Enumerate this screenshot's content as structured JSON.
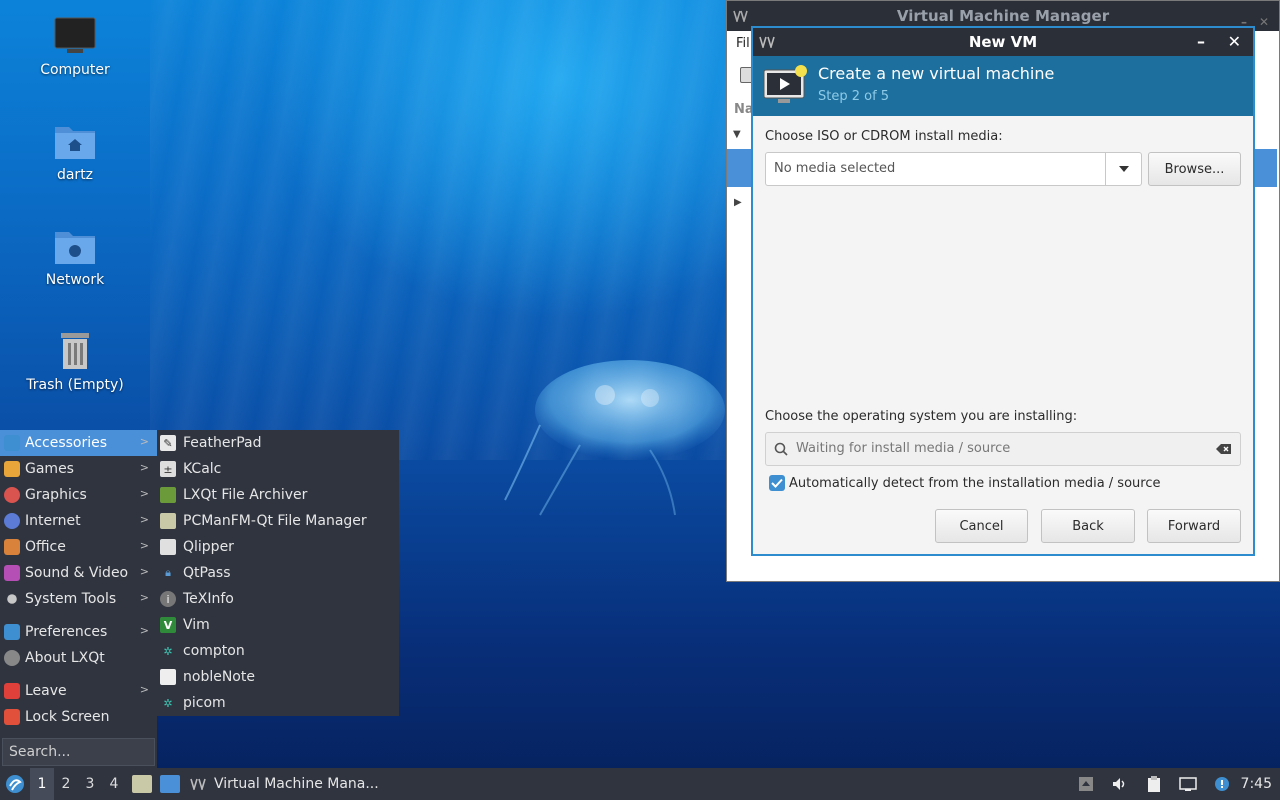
{
  "desktop": {
    "icons": [
      {
        "label": "Computer"
      },
      {
        "label": "dartz"
      },
      {
        "label": "Network"
      },
      {
        "label": "Trash (Empty)"
      }
    ]
  },
  "menu": {
    "items": [
      {
        "label": "Accessories",
        "icon": "accessories-icon",
        "color": "#3d8fd1",
        "submenu": true
      },
      {
        "label": "Games",
        "icon": "games-icon",
        "color": "#e8a53a",
        "submenu": true
      },
      {
        "label": "Graphics",
        "icon": "graphics-icon",
        "color": "#d9534f",
        "submenu": true
      },
      {
        "label": "Internet",
        "icon": "internet-icon",
        "color": "#5b7bd6",
        "submenu": true
      },
      {
        "label": "Office",
        "icon": "office-icon",
        "color": "#d9823b",
        "submenu": true
      },
      {
        "label": "Sound & Video",
        "icon": "sound-video-icon",
        "color": "#b54fb5",
        "submenu": true
      },
      {
        "label": "System Tools",
        "icon": "system-tools-icon",
        "color": "#c8c8c8",
        "submenu": true
      },
      {
        "label": "Preferences",
        "icon": "preferences-icon",
        "color": "#3d8fd1",
        "submenu": true
      },
      {
        "label": "About LXQt",
        "icon": "about-icon",
        "color": "#888888",
        "submenu": false
      },
      {
        "label": "Leave",
        "icon": "leave-icon",
        "color": "#e0403a",
        "submenu": true
      },
      {
        "label": "Lock Screen",
        "icon": "lock-icon",
        "color": "#e0503a",
        "submenu": false
      }
    ],
    "search_placeholder": "Search..."
  },
  "submenu": {
    "items": [
      {
        "label": "FeatherPad",
        "icon": "featherpad-icon"
      },
      {
        "label": "KCalc",
        "icon": "kcalc-icon"
      },
      {
        "label": "LXQt File Archiver",
        "icon": "archiver-icon"
      },
      {
        "label": "PCManFM-Qt File Manager",
        "icon": "file-manager-icon"
      },
      {
        "label": "Qlipper",
        "icon": "qlipper-icon"
      },
      {
        "label": "QtPass",
        "icon": "qtpass-icon"
      },
      {
        "label": "TeXInfo",
        "icon": "texinfo-icon"
      },
      {
        "label": "Vim",
        "icon": "vim-icon"
      },
      {
        "label": "compton",
        "icon": "compton-icon"
      },
      {
        "label": "nobleNote",
        "icon": "noblenote-icon"
      },
      {
        "label": "picom",
        "icon": "picom-icon"
      }
    ]
  },
  "taskbar": {
    "workspaces": [
      "1",
      "2",
      "3",
      "4"
    ],
    "task_label": "Virtual Machine Mana...",
    "clock": "7:45"
  },
  "vmm": {
    "title": "Virtual Machine Manager",
    "menu_fragment": "Fil",
    "col_fragment": "Na"
  },
  "dialog": {
    "title": "New VM",
    "header_title": "Create a new virtual machine",
    "step": "Step 2 of 5",
    "iso_label": "Choose ISO or CDROM install media:",
    "iso_value": "No media selected",
    "browse": "Browse...",
    "os_label": "Choose the operating system you are installing:",
    "os_placeholder": "Waiting for install media / source",
    "auto_detect": "Automatically detect from the installation media / source",
    "auto_detect_checked": true,
    "cancel": "Cancel",
    "back": "Back",
    "forward": "Forward"
  },
  "colors": {
    "accent": "#2d8ccd",
    "header": "#1d6f9d",
    "panel": "#2f343f"
  }
}
